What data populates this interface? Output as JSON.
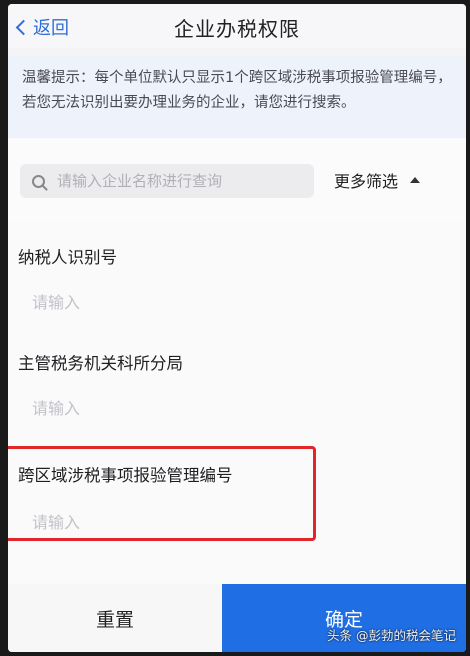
{
  "header": {
    "back_label": "返回",
    "title": "企业办税权限"
  },
  "notice": {
    "text": "温馨提示：每个单位默认只显示1个跨区域涉税事项报验管理编号，若您无法识别出要办理业务的企业，请您进行搜索。"
  },
  "search": {
    "placeholder": "请输入企业名称进行查询",
    "more_filter_label": "更多筛选"
  },
  "fields": [
    {
      "label": "纳税人识别号",
      "placeholder": "请输入"
    },
    {
      "label": "主管税务机关科所分局",
      "placeholder": "请输入"
    },
    {
      "label": "跨区域涉税事项报验管理编号",
      "placeholder": "请输入"
    }
  ],
  "actions": {
    "reset_label": "重置",
    "confirm_label": "确定"
  },
  "watermark": "头条 @彭勃的税会笔记",
  "colors": {
    "accent": "#1f6ee3",
    "highlight": "#e0262a"
  }
}
